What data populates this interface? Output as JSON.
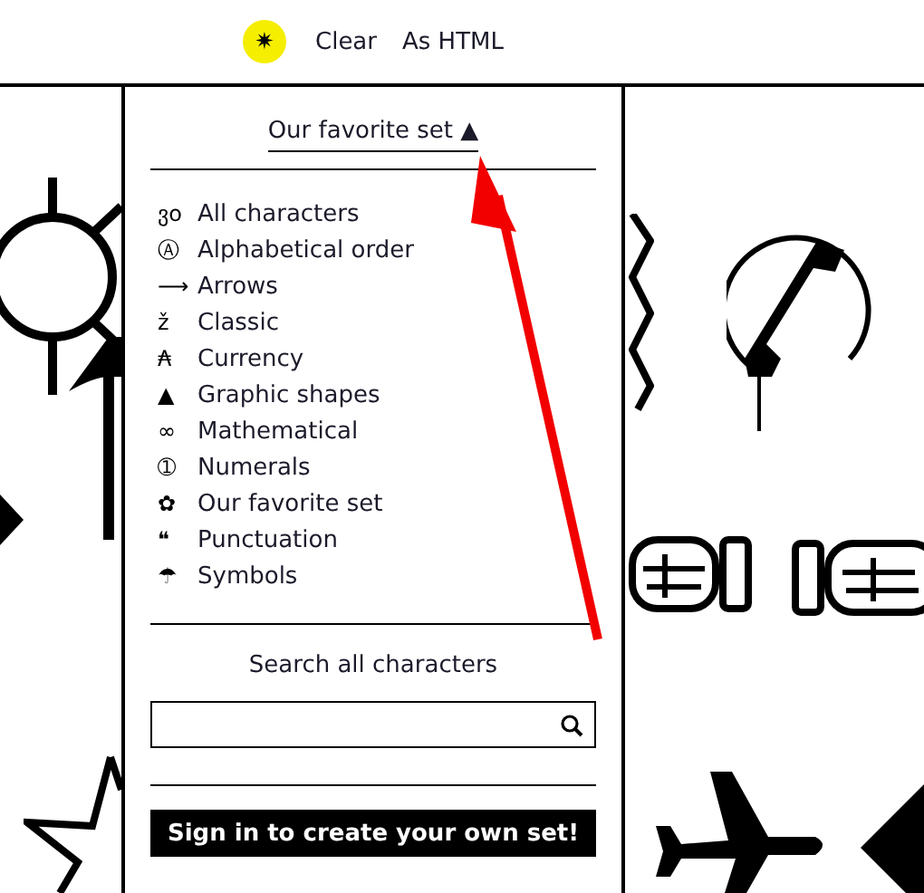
{
  "toolbar": {
    "icon_glyph": "✷",
    "links": [
      "Clear",
      "As HTML"
    ]
  },
  "dropdown": {
    "current": "Our favorite set",
    "caret": "▲",
    "categories": [
      {
        "icon": "ვo",
        "label": "All characters"
      },
      {
        "icon": "Ⓐ",
        "label": "Alphabetical order"
      },
      {
        "icon": "⟶",
        "label": "Arrows"
      },
      {
        "icon": "ž",
        "label": "Classic"
      },
      {
        "icon": "₳",
        "label": "Currency"
      },
      {
        "icon": "▲",
        "label": "Graphic shapes"
      },
      {
        "icon": "∞",
        "label": "Mathematical"
      },
      {
        "icon": "➀",
        "label": "Numerals"
      },
      {
        "icon": "✿",
        "label": "Our favorite set"
      },
      {
        "icon": "❝",
        "label": "Punctuation"
      },
      {
        "icon": "☂",
        "label": "Symbols"
      }
    ],
    "search_heading": "Search all characters",
    "signin_button": "Sign in to create your own set!"
  }
}
